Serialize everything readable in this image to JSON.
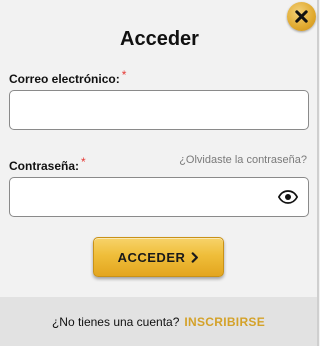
{
  "header": {
    "title": "Acceder"
  },
  "email": {
    "label": "Correo electrónico:",
    "required_mark": "*",
    "value": "",
    "placeholder": ""
  },
  "password": {
    "label": "Contraseña:",
    "required_mark": "*",
    "value": "",
    "placeholder": "",
    "forgot_link": "¿Olvidaste la contraseña?"
  },
  "submit": {
    "label": "ACCEDER"
  },
  "footer": {
    "question": "¿No tienes una cuenta?",
    "signup_link": "INSCRIBIRSE"
  },
  "icons": {
    "close": "close-icon",
    "eye": "eye-icon",
    "chevron": "chevron-right-icon"
  },
  "colors": {
    "accent": "#e8b22e",
    "signup": "#d4a22a",
    "required": "#e53935",
    "footer_bg": "#e2e2e2"
  }
}
